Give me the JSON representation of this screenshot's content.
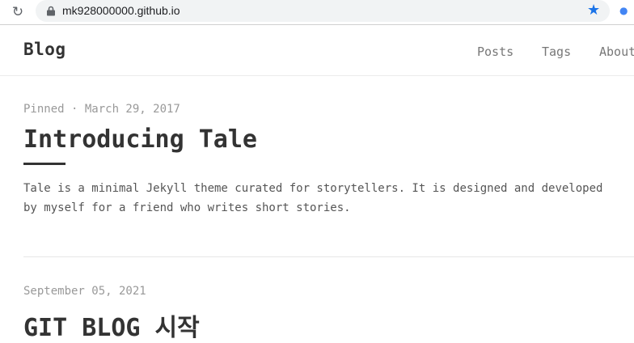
{
  "browser": {
    "url": "mk928000000.github.io",
    "reload_icon": "reload-icon",
    "lock_icon": "lock-icon",
    "star_icon": "star-icon",
    "extension_icon": "extension-icon"
  },
  "site": {
    "title": "Blog",
    "nav": [
      "Posts",
      "Tags",
      "About"
    ]
  },
  "posts": [
    {
      "meta": "Pinned · March 29, 2017",
      "title": "Introducing Tale",
      "excerpt": "Tale is a minimal Jekyll theme curated for storytellers. It is designed and developed by myself for a friend who writes short stories."
    },
    {
      "meta": "September 05, 2021",
      "title": "GIT BLOG 시작"
    }
  ],
  "colors": {
    "accent": "#1a73e8",
    "text": "#333333",
    "muted": "#999999"
  }
}
